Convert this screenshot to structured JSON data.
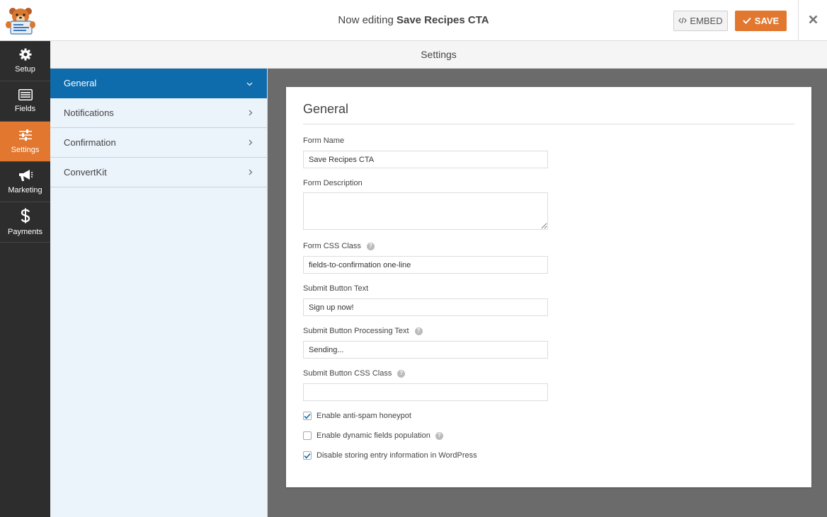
{
  "header": {
    "title_prefix": "Now editing",
    "form_name": "Save Recipes CTA",
    "embed_label": "EMBED",
    "save_label": "SAVE",
    "accent_color": "#e27730"
  },
  "leftnav": {
    "items": [
      {
        "label": "Setup",
        "icon": "gear-icon",
        "active": false
      },
      {
        "label": "Fields",
        "icon": "list-icon",
        "active": false
      },
      {
        "label": "Settings",
        "icon": "sliders-icon",
        "active": true
      },
      {
        "label": "Marketing",
        "icon": "megaphone-icon",
        "active": false
      },
      {
        "label": "Payments",
        "icon": "dollar-icon",
        "active": false
      }
    ]
  },
  "settings_header": "Settings",
  "subnav": {
    "items": [
      {
        "label": "General",
        "active": true
      },
      {
        "label": "Notifications",
        "active": false
      },
      {
        "label": "Confirmation",
        "active": false
      },
      {
        "label": "ConvertKit",
        "active": false
      }
    ],
    "active_color": "#0e6cad"
  },
  "panel": {
    "title": "General",
    "form_name_label": "Form Name",
    "form_name_value": "Save Recipes CTA",
    "form_description_label": "Form Description",
    "form_description_value": "",
    "css_class_label": "Form CSS Class",
    "css_class_value": "fields-to-confirmation one-line",
    "submit_text_label": "Submit Button Text",
    "submit_text_value": "Sign up now!",
    "processing_text_label": "Submit Button Processing Text",
    "processing_text_value": "Sending...",
    "submit_css_label": "Submit Button CSS Class",
    "submit_css_value": "",
    "honeypot_label": "Enable anti-spam honeypot",
    "honeypot_checked": true,
    "dynamic_label": "Enable dynamic fields population",
    "dynamic_checked": false,
    "disable_storing_label": "Disable storing entry information in WordPress",
    "disable_storing_checked": true
  }
}
